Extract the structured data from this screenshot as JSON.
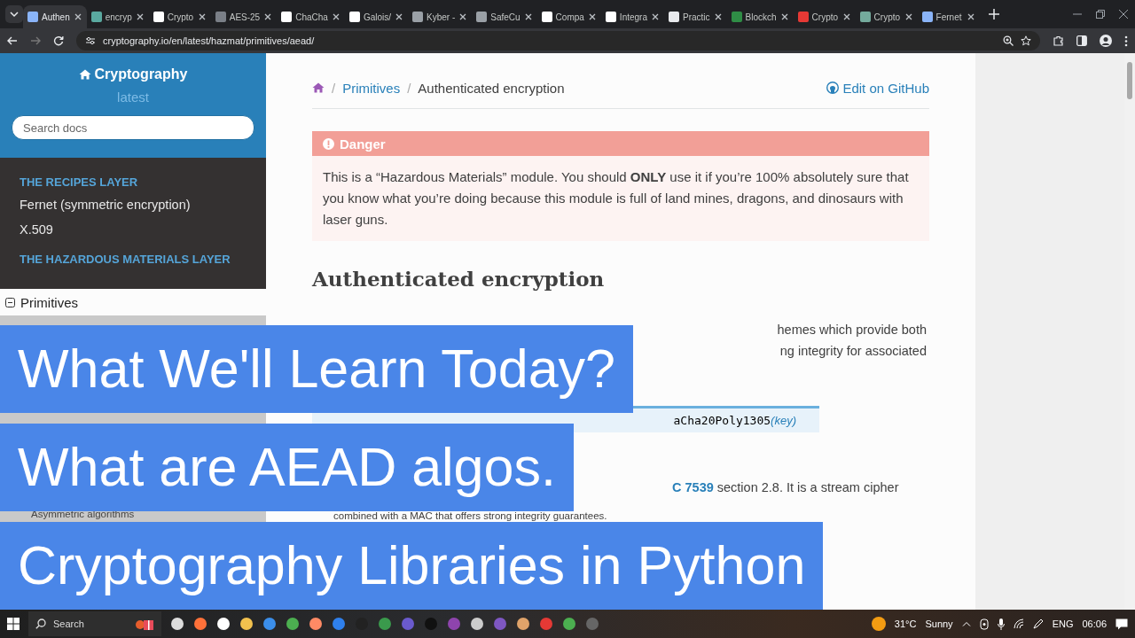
{
  "browser": {
    "tabs": [
      {
        "title": "Authen",
        "selected": true,
        "color": "#8ab4f8"
      },
      {
        "title": "encryp",
        "selected": false,
        "color": "#5aa9a0"
      },
      {
        "title": "Crypto",
        "selected": false,
        "color": "#ffffff"
      },
      {
        "title": "AES-25",
        "selected": false,
        "color": "#7a7f87"
      },
      {
        "title": "ChaCha",
        "selected": false,
        "color": "#ffffff"
      },
      {
        "title": "Galois/",
        "selected": false,
        "color": "#ffffff"
      },
      {
        "title": "Kyber -",
        "selected": false,
        "color": "#9aa0a6"
      },
      {
        "title": "SafeCu",
        "selected": false,
        "color": "#9aa0a6"
      },
      {
        "title": "Compa",
        "selected": false,
        "color": "#ffffff"
      },
      {
        "title": "Integra",
        "selected": false,
        "color": "#ffffff"
      },
      {
        "title": "Practic",
        "selected": false,
        "color": "#e8eaed"
      },
      {
        "title": "Blockch",
        "selected": false,
        "color": "#2f8d46"
      },
      {
        "title": "Crypto",
        "selected": false,
        "color": "#e53935"
      },
      {
        "title": "Crypto",
        "selected": false,
        "color": "#74aa9c"
      },
      {
        "title": "Fernet",
        "selected": false,
        "color": "#8ab4f8"
      }
    ],
    "url": "cryptography.io/en/latest/hazmat/primitives/aead/"
  },
  "sidebar": {
    "title": "Cryptography",
    "version": "latest",
    "search": {
      "placeholder": "Search docs"
    },
    "sections": [
      {
        "caption": "THE RECIPES LAYER",
        "items": [
          "Fernet (symmetric encryption)",
          "X.509"
        ]
      },
      {
        "caption": "THE HAZARDOUS MATERIALS LAYER"
      }
    ],
    "tree": [
      {
        "label": "Primitives",
        "expanded": true
      }
    ],
    "partial_item": "Asymmetric algorithms"
  },
  "content": {
    "breadcrumb": [
      {
        "separator": "/",
        "label": "Primitives"
      },
      {
        "separator": "/",
        "label": "Authenticated encryption"
      }
    ],
    "edit_link": "Edit on GitHub",
    "admonition": {
      "title": "Danger",
      "body": "This is a “Hazardous Materials” module. You should **ONLY** use it if you’re 100% absolutely sure that you know what you’re doing because this module is full of land mines, dragons, and dinosaurs with laser guns."
    },
    "heading": "Authenticated encryption",
    "intro_lines": [
      "hemes which provide both",
      "ng integrity for associated"
    ],
    "signature": {
      "name": "aCha20Poly1305",
      "params": "(key)"
    },
    "description": {
      "link": "C 7539",
      "text": "section 2.8. It is a stream cipher",
      "line_2": "combined with a MAC that offers strong integrity guarantees."
    }
  },
  "banners": [
    "What We'll Learn Today?",
    "What are AEAD algos.",
    "Cryptography Libraries in Python"
  ],
  "taskbar": {
    "search": "Search",
    "temperature": "31°C",
    "weather": "Sunny",
    "language": "ENG",
    "time": "06:06"
  }
}
